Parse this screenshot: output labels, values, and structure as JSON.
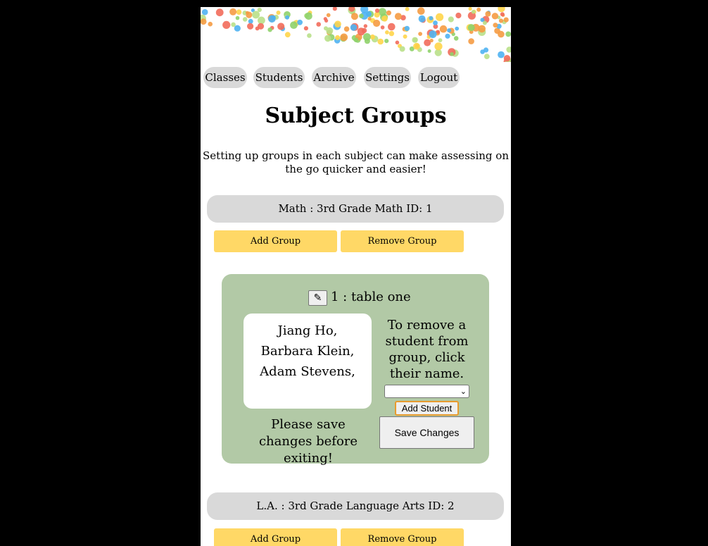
{
  "nav": {
    "classes": "Classes",
    "students": "Students",
    "archive": "Archive",
    "settings": "Settings",
    "logout": "Logout"
  },
  "heading": "Subject Groups",
  "intro": "Setting up groups in each subject can make assessing on the go quicker and easier!",
  "subjects": [
    {
      "label": "Math : 3rd Grade Math ID: 1",
      "add_group": "Add Group",
      "remove_group": "Remove Group",
      "group": {
        "title": "1 : table one",
        "edit_icon": "pencil-icon",
        "members": [
          "Jiang Ho,",
          "Barbara Klein,",
          "Adam Stevens,"
        ],
        "remove_hint": "To remove a student from group, click their name.",
        "select_value": "",
        "add_student": "Add Student",
        "save_hint": "Please save changes before exiting!",
        "save_changes": "Save Changes"
      }
    },
    {
      "label": "L.A. : 3rd Grade Language Arts ID: 2",
      "add_group": "Add Group",
      "remove_group": "Remove Group"
    }
  ],
  "colors": {
    "nav_bg": "#d9d9d9",
    "gold_button": "#ffd866",
    "group_card": "#b2c9a6",
    "focus_outline": "#e89b2e"
  }
}
